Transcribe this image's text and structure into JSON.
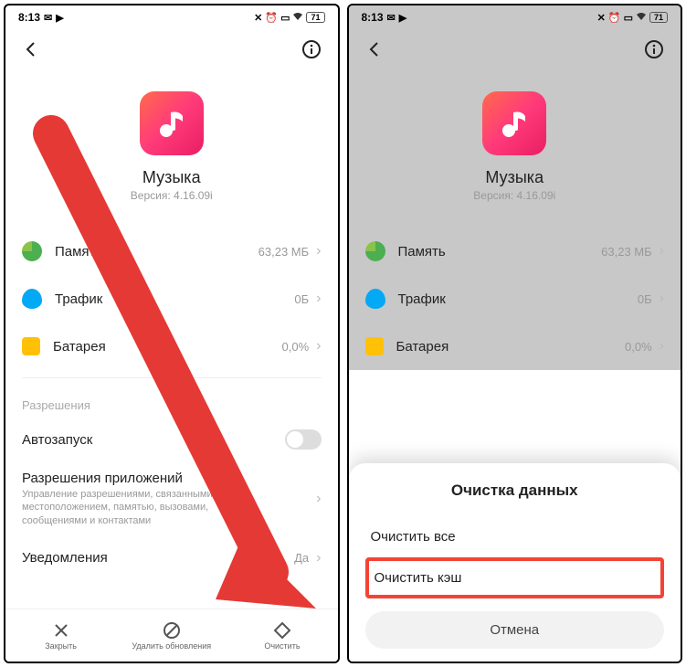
{
  "statusbar": {
    "time": "8:13",
    "battery": "71"
  },
  "header": {},
  "app": {
    "name": "Музыка",
    "version_prefix": "Версия:",
    "version": "4.16.09i"
  },
  "rows": {
    "storage": {
      "label": "Память",
      "value": "63,23 МБ"
    },
    "data": {
      "label": "Трафик",
      "value": "0Б"
    },
    "battery": {
      "label": "Батарея",
      "value": "0,0%"
    }
  },
  "permissions_section": "Разрешения",
  "settings": {
    "autostart": {
      "label": "Автозапуск"
    },
    "perms": {
      "label": "Разрешения приложений",
      "desc": "Управление разрешениями, связанными с местоположением, памятью, вызовами, сообщениями и контактами"
    },
    "notifications": {
      "label": "Уведомления",
      "value": "Да"
    }
  },
  "bottom_actions": {
    "close": "Закрыть",
    "uninstall_updates": "Удалить обновления",
    "clear": "Очистить"
  },
  "sheet": {
    "title": "Очистка данных",
    "clear_all": "Очистить все",
    "clear_cache": "Очистить кэш",
    "cancel": "Отмена"
  }
}
